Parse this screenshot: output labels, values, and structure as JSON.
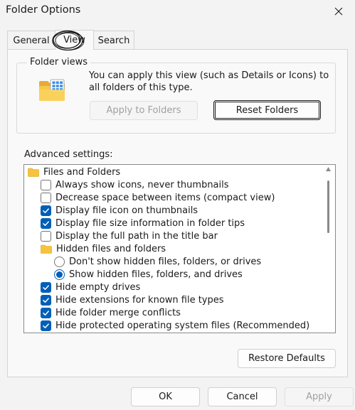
{
  "window": {
    "title": "Folder Options"
  },
  "tabs": [
    "General",
    "View",
    "Search"
  ],
  "folder_views": {
    "legend": "Folder views",
    "description": "You can apply this view (such as Details or Icons) to all folders of this type.",
    "apply_button": "Apply to Folders",
    "reset_button": "Reset Folders"
  },
  "advanced": {
    "label": "Advanced settings:",
    "items": [
      {
        "type": "folder",
        "label": "Files and Folders"
      },
      {
        "type": "checkbox",
        "checked": false,
        "label": "Always show icons, never thumbnails"
      },
      {
        "type": "checkbox",
        "checked": false,
        "label": "Decrease space between items (compact view)"
      },
      {
        "type": "checkbox",
        "checked": true,
        "label": "Display file icon on thumbnails"
      },
      {
        "type": "checkbox",
        "checked": true,
        "label": "Display file size information in folder tips"
      },
      {
        "type": "checkbox",
        "checked": false,
        "label": "Display the full path in the title bar"
      },
      {
        "type": "folder",
        "label": "Hidden files and folders"
      },
      {
        "type": "radio",
        "checked": false,
        "label": "Don't show hidden files, folders, or drives"
      },
      {
        "type": "radio",
        "checked": true,
        "label": "Show hidden files, folders, and drives"
      },
      {
        "type": "checkbox",
        "checked": true,
        "label": "Hide empty drives"
      },
      {
        "type": "checkbox",
        "checked": true,
        "label": "Hide extensions for known file types"
      },
      {
        "type": "checkbox",
        "checked": true,
        "label": "Hide folder merge conflicts"
      },
      {
        "type": "checkbox",
        "checked": true,
        "label": "Hide protected operating system files (Recommended)"
      }
    ],
    "restore_button": "Restore Defaults"
  },
  "footer": {
    "ok": "OK",
    "cancel": "Cancel",
    "apply": "Apply"
  },
  "colors": {
    "accent": "#005fb8",
    "background": "#f3f3f3",
    "panel": "#f9f9f9",
    "folder": "#f7c33d"
  }
}
